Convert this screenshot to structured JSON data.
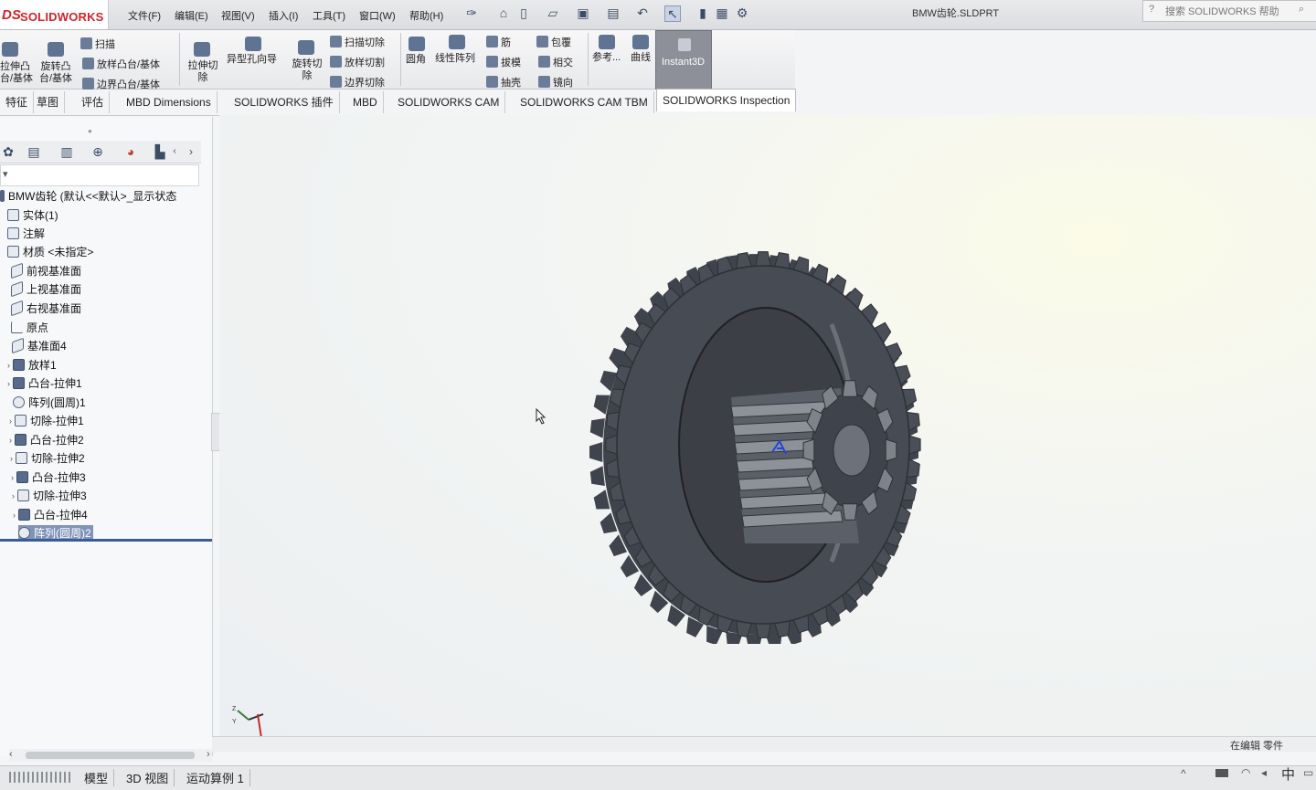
{
  "app": {
    "logo_ds": "DS",
    "logo_name": "SOLIDWORKS"
  },
  "menu": [
    "文件(F)",
    "编辑(E)",
    "视图(V)",
    "插入(I)",
    "工具(T)",
    "窗口(W)",
    "帮助(H)"
  ],
  "document_title": "BMW齿轮.SLDPRT",
  "help_search": {
    "placeholder": "搜索 SOLIDWORKS 帮助"
  },
  "ribbon": {
    "extrude_boss": [
      "拉伸凸",
      "台/基体"
    ],
    "revolve_boss": [
      "旋转凸",
      "台/基体"
    ],
    "sweep": "扫描",
    "loft_boss": "放样凸台/基体",
    "boundary_boss": "边界凸台/基体",
    "extrude_cut": [
      "拉伸切",
      "除"
    ],
    "hole_wizard": "异型孔向导",
    "revolve_cut": [
      "旋转切",
      "除"
    ],
    "swept_cut": "扫描切除",
    "lofted_cut": "放样切割",
    "boundary_cut": "边界切除",
    "fillet": "圆角",
    "linear_pattern": "线性阵列",
    "rib": "筋",
    "draft": "拔模",
    "shell": "抽壳",
    "wrap": "包覆",
    "intersect": "相交",
    "mirror": "镜向",
    "reference": "参考...",
    "curves": "曲线",
    "instant3d": "Instant3D"
  },
  "tabs": [
    "特征",
    "草图",
    "评估",
    "MBD Dimensions",
    "SOLIDWORKS 插件",
    "MBD",
    "SOLIDWORKS CAM",
    "SOLIDWORKS CAM TBM",
    "SOLIDWORKS Inspection"
  ],
  "feature_tree": {
    "root": "BMW齿轮 (默认<<默认>_显示状态",
    "items": [
      {
        "label": "实体(1)",
        "icon": "solid-bodies-folder-icon"
      },
      {
        "label": "注解",
        "icon": "annotations-icon"
      },
      {
        "label": "材质 <未指定>",
        "icon": "material-icon"
      },
      {
        "label": "前视基准面",
        "icon": "plane-icon"
      },
      {
        "label": "上视基准面",
        "icon": "plane-icon"
      },
      {
        "label": "右视基准面",
        "icon": "plane-icon"
      },
      {
        "label": "原点",
        "icon": "origin-icon"
      },
      {
        "label": "基准面4",
        "icon": "plane-icon"
      },
      {
        "label": "放样1",
        "icon": "loft-feature-icon"
      },
      {
        "label": "凸台-拉伸1",
        "icon": "boss-extrude-icon"
      },
      {
        "label": "阵列(圆周)1",
        "icon": "circular-pattern-icon"
      },
      {
        "label": "切除-拉伸1",
        "icon": "cut-extrude-icon"
      },
      {
        "label": "凸台-拉伸2",
        "icon": "boss-extrude-icon"
      },
      {
        "label": "切除-拉伸2",
        "icon": "cut-extrude-icon"
      },
      {
        "label": "凸台-拉伸3",
        "icon": "boss-extrude-icon"
      },
      {
        "label": "切除-拉伸3",
        "icon": "cut-extrude-icon"
      },
      {
        "label": "凸台-拉伸4",
        "icon": "boss-extrude-icon"
      },
      {
        "label": "阵列(圆周)2",
        "icon": "circular-pattern-icon"
      }
    ]
  },
  "bottom_tabs": [
    "模型",
    "3D 视图",
    "运动算例 1"
  ],
  "status": {
    "text": "在编辑 零件"
  },
  "tray": {
    "ime": "中"
  },
  "colors": {
    "accent_red": "#d3232b",
    "selection": "#7f94b8",
    "gear": "#4a4e56"
  }
}
